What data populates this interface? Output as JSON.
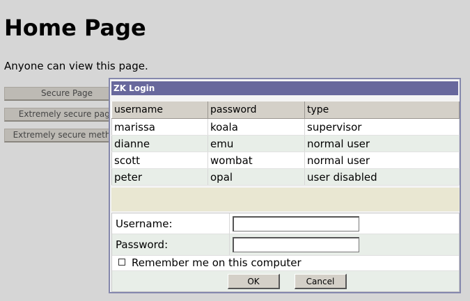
{
  "page": {
    "title": "Home Page",
    "description": "Anyone can view this page."
  },
  "nav": {
    "buttons": [
      {
        "label": "Secure Page"
      },
      {
        "label": "Extremely secure page"
      },
      {
        "label": "Extremely secure method"
      }
    ]
  },
  "login_dialog": {
    "title": "ZK Login",
    "table": {
      "headers": [
        "username",
        "password",
        "type"
      ],
      "rows": [
        [
          "marissa",
          "koala",
          "supervisor"
        ],
        [
          "dianne",
          "emu",
          "normal user"
        ],
        [
          "scott",
          "wombat",
          "normal user"
        ],
        [
          "peter",
          "opal",
          "user disabled"
        ]
      ]
    },
    "form": {
      "username_label": "Username:",
      "username_value": "",
      "password_label": "Password:",
      "password_value": "",
      "remember_label": "Remember me on this computer",
      "remember_checked": false,
      "ok_label": "OK",
      "cancel_label": "Cancel"
    }
  },
  "colors": {
    "background": "#d6d6d6",
    "dialog_title_bar": "#68689c",
    "dialog_border": "#8588ad",
    "alt_row": "#e8eee8",
    "spacer_band": "#e9e7d2"
  }
}
